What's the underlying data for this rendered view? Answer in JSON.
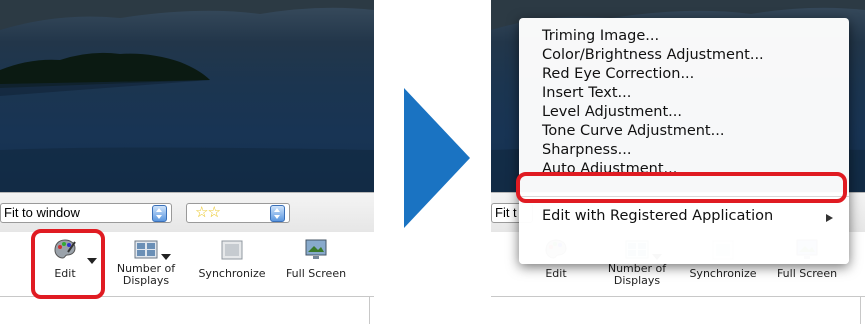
{
  "left": {
    "zoom_select": "Fit to window",
    "rating_stars": "☆☆",
    "buttons": [
      {
        "label": "Edit"
      },
      {
        "label": "Number of\nDisplays"
      },
      {
        "label": "Synchronize"
      },
      {
        "label": "Full Screen"
      }
    ]
  },
  "right": {
    "zoom_select_partial": "Fit t",
    "menu": {
      "items": [
        "Triming Image...",
        "Color/Brightness Adjustment...",
        "Red Eye Correction...",
        "Insert Text...",
        "Level Adjustment...",
        "Tone Curve Adjustment...",
        "Sharpness...",
        "Auto Adjustment..."
      ],
      "registered_app": "Edit with Registered Application",
      "highlighted_item": "Auto Adjustment..."
    },
    "buttons": [
      {
        "label": "Edit"
      },
      {
        "label": "Number of\nDisplays"
      },
      {
        "label": "Synchronize"
      },
      {
        "label": "Full Screen"
      }
    ]
  },
  "colors": {
    "highlight": "#e01b22",
    "arrow": "#1a73c2",
    "stars": "#e9c31a"
  }
}
